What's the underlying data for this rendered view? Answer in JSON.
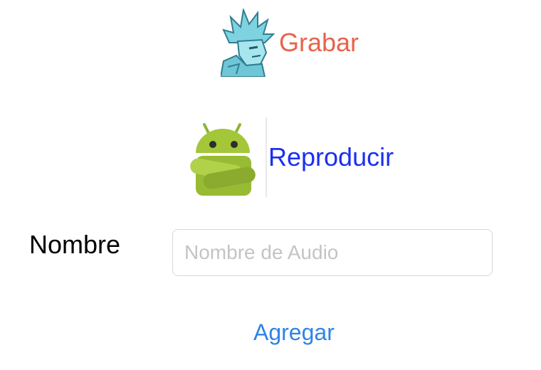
{
  "record": {
    "label": "Grabar",
    "icon": "ice-warrior-icon",
    "color": "#e8634b"
  },
  "play": {
    "label": "Reproducir",
    "icon": "android-mascot-icon",
    "color": "#1c2ff0"
  },
  "form": {
    "name_label": "Nombre",
    "name_value": "",
    "name_placeholder": "Nombre de Audio"
  },
  "add": {
    "label": "Agregar",
    "color": "#2f84e6"
  }
}
